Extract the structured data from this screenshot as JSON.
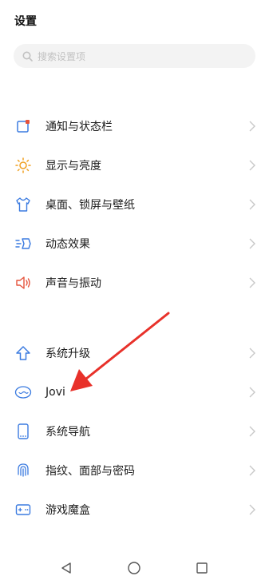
{
  "header": {
    "title": "设置"
  },
  "search": {
    "placeholder": "搜索设置项",
    "icon": "search-icon"
  },
  "group1": [
    {
      "label": "通知与状态栏",
      "icon": "notification-icon",
      "color": "#e5533c"
    },
    {
      "label": "显示与亮度",
      "icon": "sun-icon",
      "color": "#f0a020"
    },
    {
      "label": "桌面、锁屏与壁纸",
      "icon": "shirt-icon",
      "color": "#3b7be0"
    },
    {
      "label": "动态效果",
      "icon": "motion-icon",
      "color": "#3b7be0"
    },
    {
      "label": "声音与振动",
      "icon": "speaker-icon",
      "color": "#e5533c"
    }
  ],
  "group2": [
    {
      "label": "系统升级",
      "icon": "upgrade-arrow-icon",
      "color": "#3b7be0"
    },
    {
      "label": "Jovi",
      "icon": "jovi-icon",
      "color": "#3b7be0"
    },
    {
      "label": "系统导航",
      "icon": "phone-navigation-icon",
      "color": "#3b7be0"
    },
    {
      "label": "指纹、面部与密码",
      "icon": "fingerprint-icon",
      "color": "#3b7be0"
    },
    {
      "label": "游戏魔盒",
      "icon": "gamepad-icon",
      "color": "#3b7be0"
    }
  ],
  "navbar": {
    "back": "back-triangle-icon",
    "home": "home-circle-icon",
    "recent": "recent-square-icon"
  },
  "annotation": {
    "arrow_color": "#e8312a"
  }
}
